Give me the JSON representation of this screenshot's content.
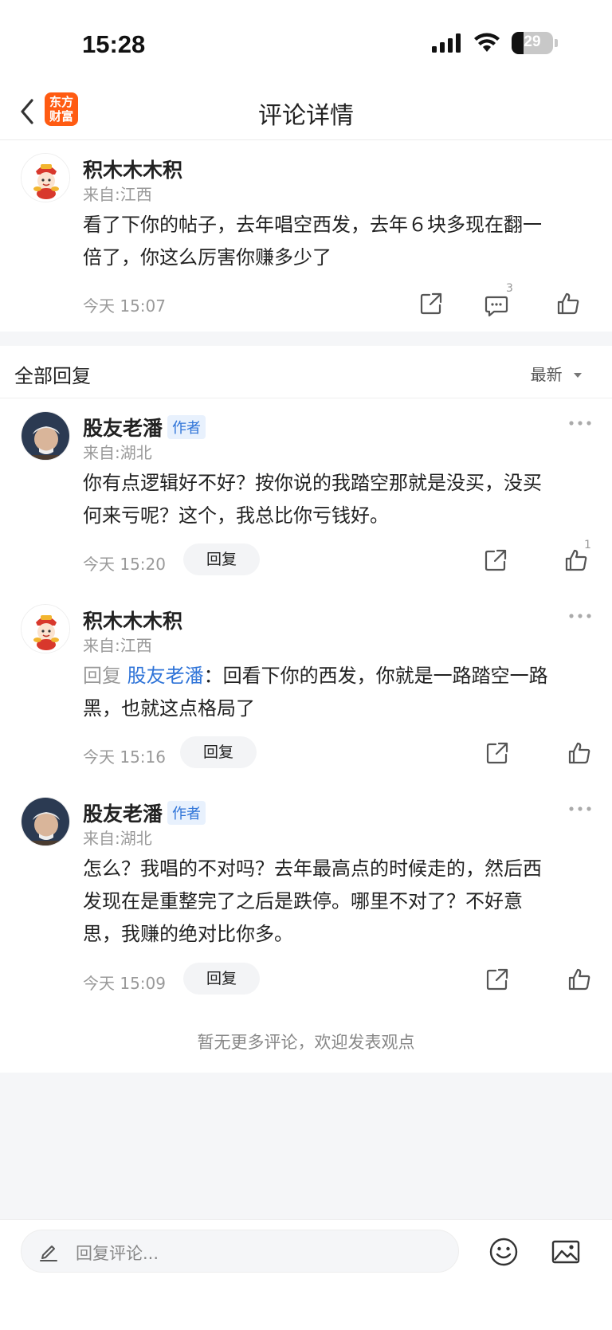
{
  "status_bar": {
    "time": "15:28",
    "battery": "29",
    "battery_level_percent": 29
  },
  "nav": {
    "brand_line1": "东方",
    "brand_line2": "财富",
    "title": "评论详情"
  },
  "main_comment": {
    "username": "积木木木积",
    "location": "来自:江西",
    "text_line1": "看了下你的帖子，去年唱空西发，去年６块多现在翻一",
    "text_line2": "倍了，你这么厉害你赚多少了",
    "time": "今天 15:07",
    "comment_count": "3"
  },
  "section": {
    "title": "全部回复",
    "sort_label": "最新"
  },
  "replies": [
    {
      "username": "股友老潘",
      "author_badge": "作者",
      "location": "来自:湖北",
      "text_line1": "你有点逻辑好不好？按你说的我踏空那就是没买，没买",
      "text_line2": "何来亏呢？这个，我总比你亏钱好。",
      "time": "今天 15:20",
      "reply_label": "回复",
      "like_count": "1"
    },
    {
      "username": "积木木木积",
      "location": "来自:江西",
      "reply_prefix": "回复",
      "reply_target": "股友老潘",
      "text_line1": "：回看下你的西发，你就是一路踏空一路",
      "text_line2": "黑，也就这点格局了",
      "time": "今天 15:16",
      "reply_label": "回复"
    },
    {
      "username": "股友老潘",
      "author_badge": "作者",
      "location": "来自:湖北",
      "text_line1": "怎么？我唱的不对吗？去年最高点的时候走的，然后西",
      "text_line2": "发现在是重整完了之后是跌停。哪里不对了？不好意",
      "text_line3": "思，我赚的绝对比你多。",
      "time": "今天 15:09",
      "reply_label": "回复"
    }
  ],
  "empty_note": "暂无更多评论，欢迎发表观点",
  "bottom": {
    "placeholder": "回复评论..."
  },
  "colors": {
    "brand": "#ff5b12",
    "link": "#2f74d8",
    "badge_bg": "#e8f1fd"
  },
  "icons": [
    "back-icon",
    "signal-icon",
    "wifi-icon",
    "share-icon",
    "comment-icon",
    "like-icon",
    "more-icon",
    "sort-down-icon",
    "pencil-icon",
    "emoji-icon",
    "image-icon"
  ]
}
